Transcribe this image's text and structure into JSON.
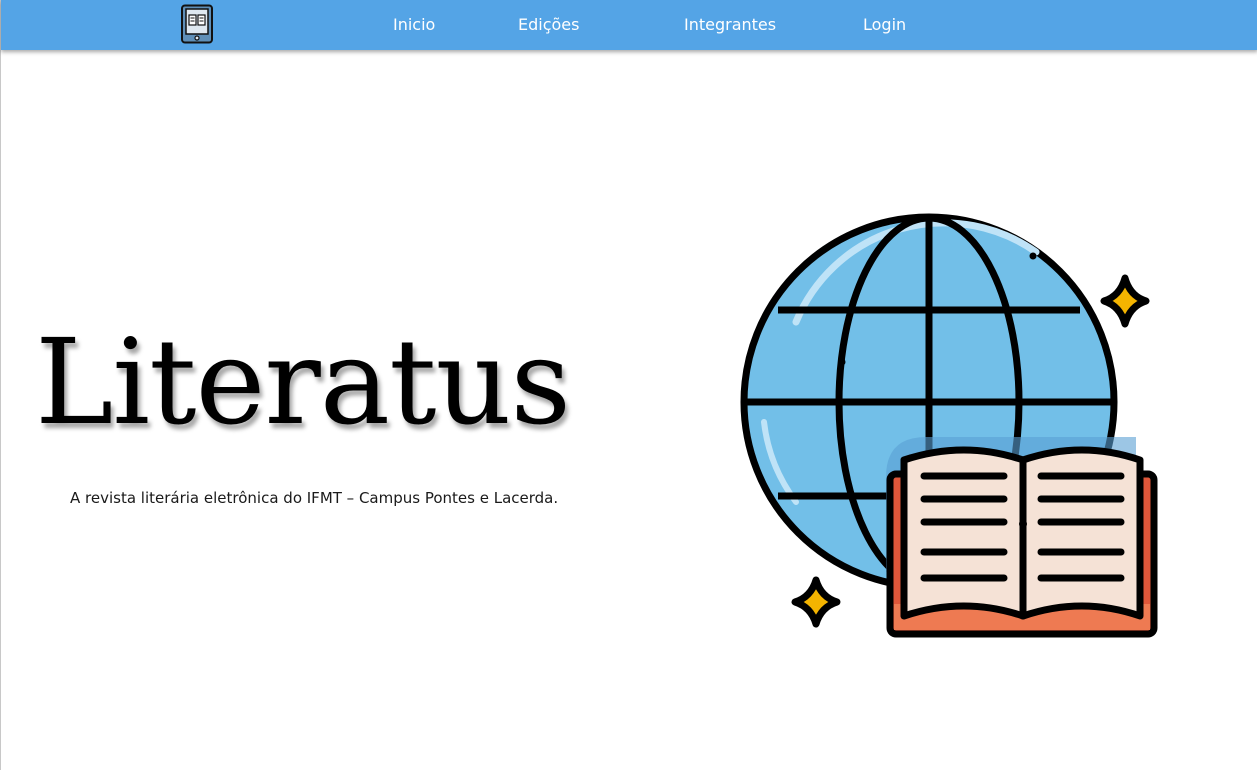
{
  "nav": {
    "logo_icon": "ebook-reader-icon",
    "links": [
      {
        "label": "Inicio"
      },
      {
        "label": "Edições"
      },
      {
        "label": "Integrantes"
      },
      {
        "label": "Login"
      }
    ]
  },
  "hero": {
    "title": "Literatus",
    "subtitle": "A revista literária eletrônica do IFMT – Campus Pontes e Lacerda.",
    "illustration_icon": "globe-with-open-book-icon"
  },
  "colors": {
    "navbar": "#54a4e6",
    "globe": "#72bfe8",
    "book_cover": "#e0573a",
    "book_pages": "#f5e2d6",
    "sparkle": "#f4b400"
  }
}
